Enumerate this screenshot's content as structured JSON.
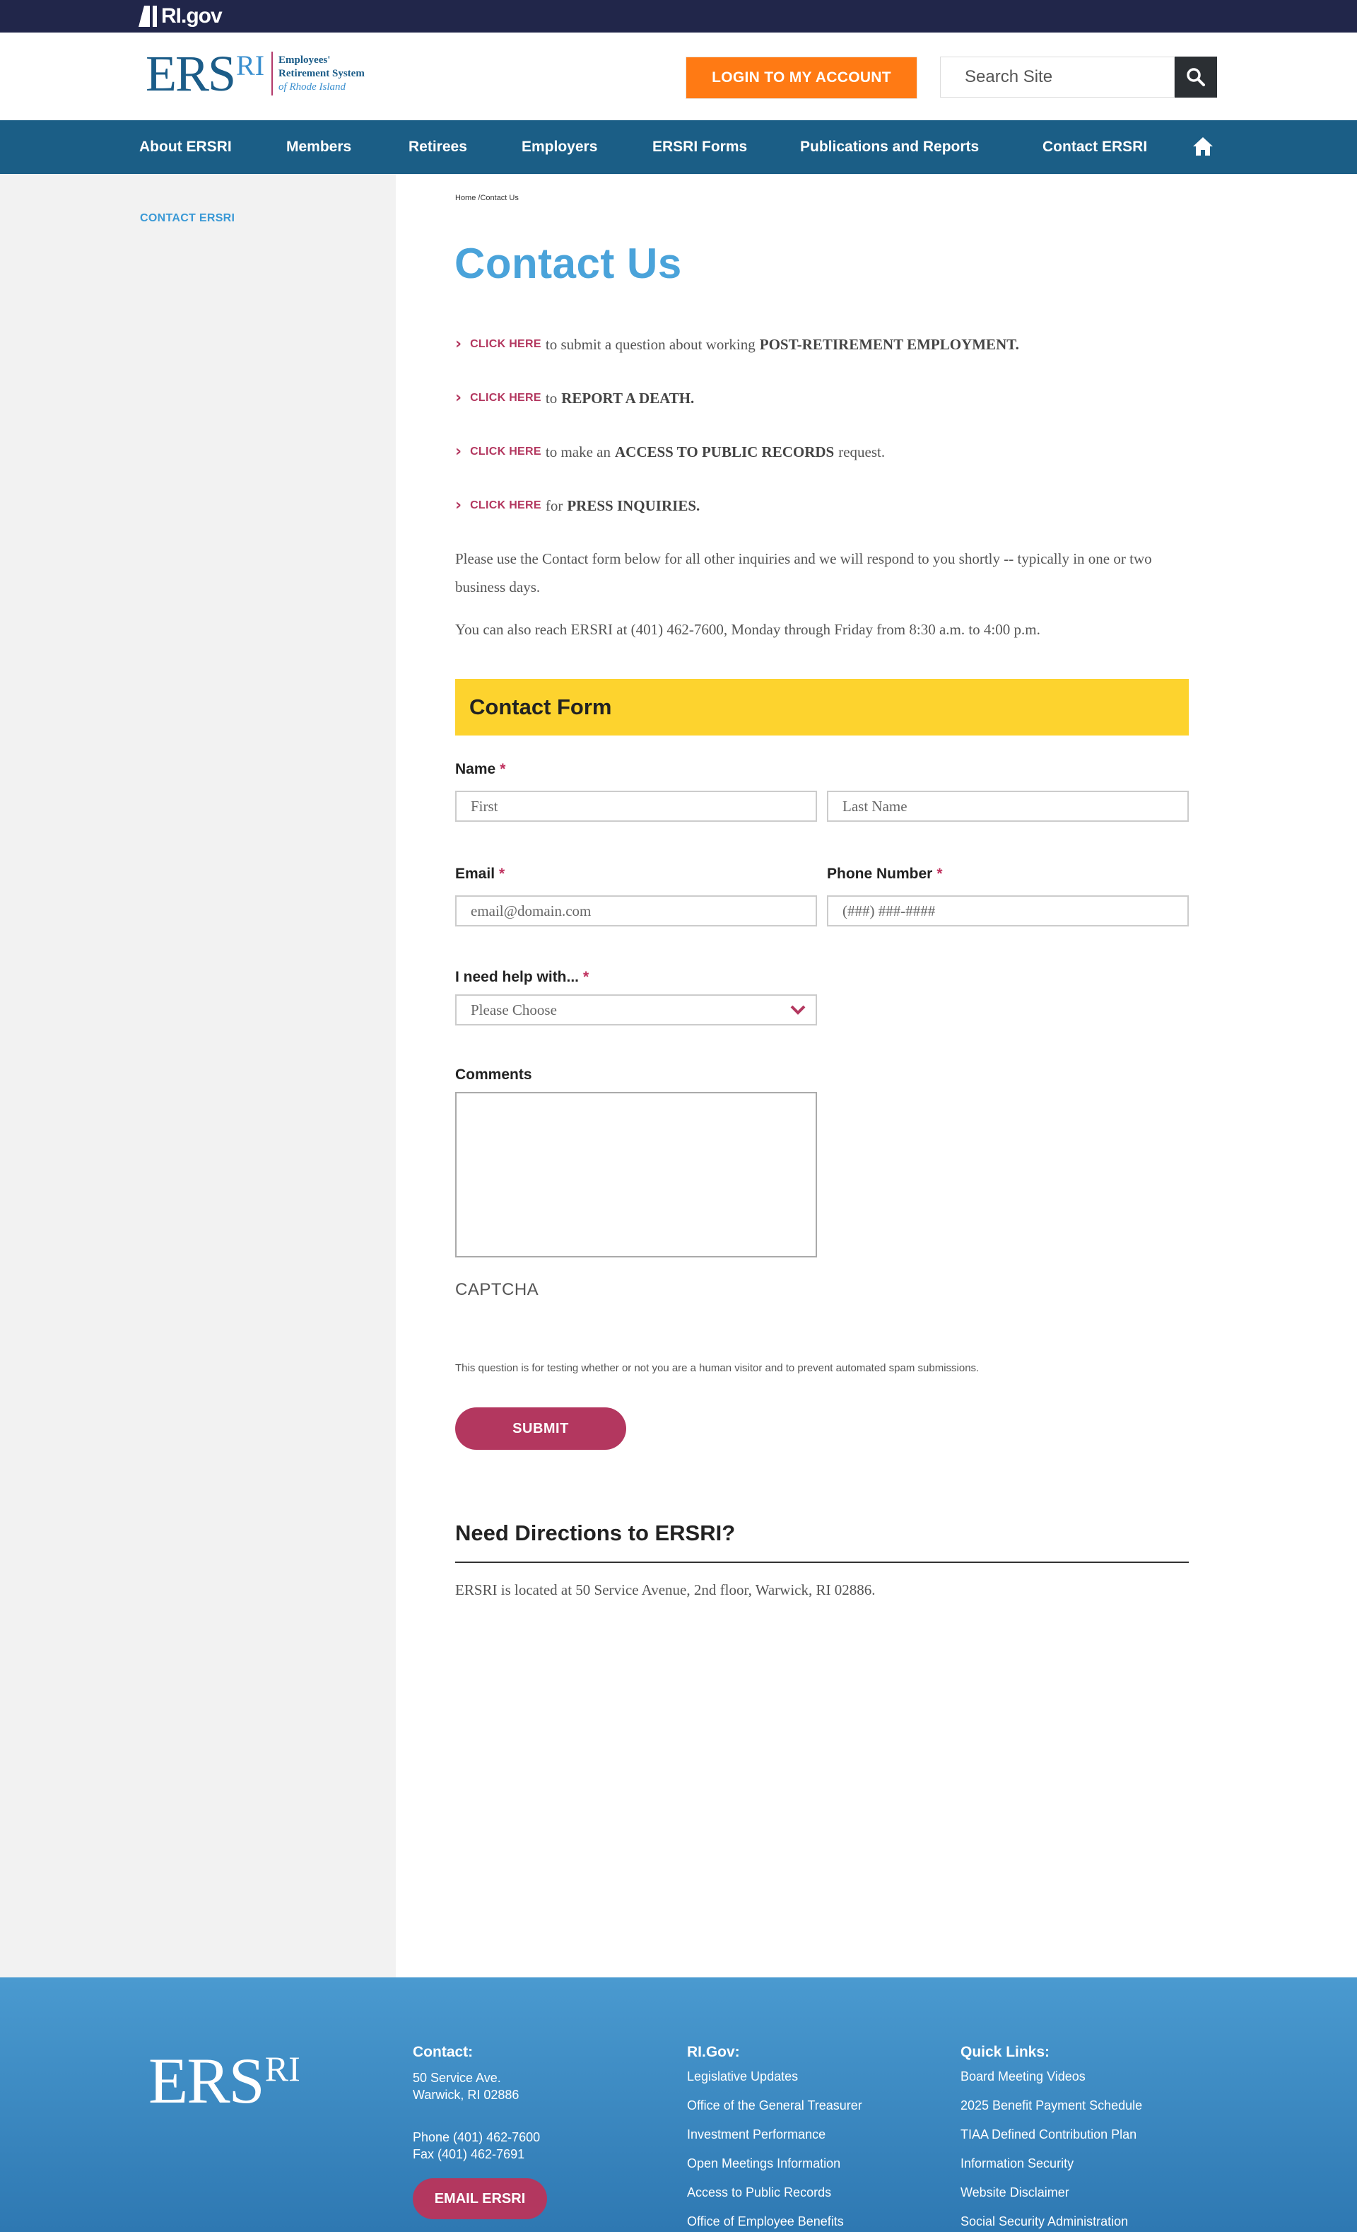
{
  "gov": {
    "logo_text": "RI.gov"
  },
  "header": {
    "logo_main": "ERS",
    "logo_ri": "RI",
    "logo_line1": "Employees'",
    "logo_line2": "Retirement System",
    "logo_line3": "of Rhode Island",
    "login_label": "LOGIN TO MY ACCOUNT",
    "search_placeholder": "Search Site",
    "search_icon": "search-icon"
  },
  "nav": {
    "items": [
      "About ERSRI",
      "Members",
      "Retirees",
      "Employers",
      "ERSRI Forms",
      "Publications and Reports",
      "Contact ERSRI"
    ],
    "home_icon": "home-icon"
  },
  "sidebar": {
    "link": "CONTACT ERSRI"
  },
  "breadcrumb": "Home /Contact Us",
  "page_title": "Contact Us",
  "links": [
    {
      "click": "CLICK HERE",
      "pre": "to submit a question about working",
      "strong": "POST-RETIREMENT EMPLOYMENT.",
      "post": ""
    },
    {
      "click": "CLICK HERE",
      "pre": "to",
      "strong": "REPORT A DEATH.",
      "post": ""
    },
    {
      "click": "CLICK HERE",
      "pre": "to make an",
      "strong": "ACCESS TO PUBLIC RECORDS",
      "post": "request."
    },
    {
      "click": "CLICK HERE",
      "pre": "for",
      "strong": "PRESS INQUIRIES.",
      "post": ""
    }
  ],
  "intro_p1": "Please use the Contact form below for all other inquiries and we will respond to you shortly -- typically in one or two business days.",
  "intro_p2": "You can also reach ERSRI at (401) 462-7600, Monday through Friday from 8:30 a.m. to 4:00 p.m.",
  "form": {
    "title": "Contact Form",
    "required_mark": "*",
    "name_label": "Name",
    "first_placeholder": "First",
    "last_placeholder": "Last Name",
    "email_label": "Email",
    "email_placeholder": "email@domain.com",
    "phone_label": "Phone Number",
    "phone_placeholder": "(###) ###-####",
    "help_label": "I need help with...",
    "help_selected": "Please Choose",
    "comments_label": "Comments",
    "captcha_label": "CAPTCHA",
    "captcha_note": "This question is for testing whether or not you are a human visitor and to prevent automated spam submissions.",
    "submit_label": "SUBMIT"
  },
  "directions": {
    "title": "Need Directions to ERSRI?",
    "text": "ERSRI is located at 50 Service Avenue, 2nd floor, Warwick, RI 02886."
  },
  "footer": {
    "logo_main": "ERS",
    "logo_ri": "RI",
    "contact_title": "Contact:",
    "address1": "50 Service Ave.",
    "address2": "Warwick, RI 02886",
    "phone": "Phone (401) 462-7600",
    "fax": "Fax (401) 462-7691",
    "email_button": "EMAIL ERSRI",
    "rigov_title": "RI.Gov:",
    "rigov_links": [
      "Legislative Updates",
      "Office of the General Treasurer",
      "Investment Performance",
      "Open Meetings Information",
      "Access to Public Records",
      "Office of Employee Benefits"
    ],
    "quick_title": "Quick Links:",
    "quick_links": [
      "Board Meeting Videos",
      "2025 Benefit Payment Schedule",
      "TIAA Defined Contribution Plan",
      "Information Security",
      "Website Disclaimer",
      "Social Security Administration"
    ]
  },
  "colors": {
    "gov_bar": "#21264a",
    "nav": "#1b5e86",
    "login": "#ff7a14",
    "accent": "#b3375f",
    "title_blue": "#4aa3da",
    "form_head": "#fdd32e"
  }
}
